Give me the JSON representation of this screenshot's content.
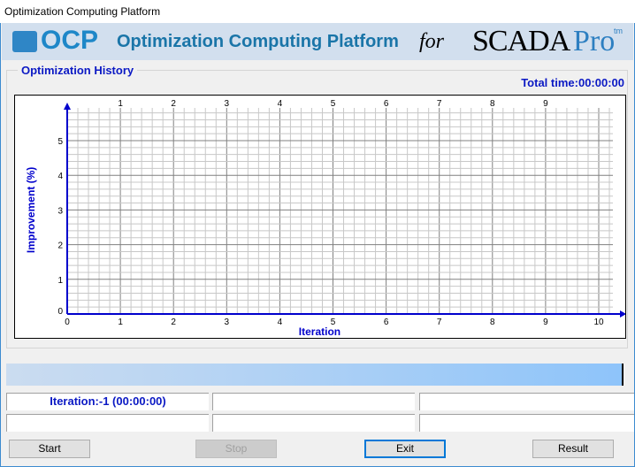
{
  "window": {
    "title": "Optimization Computing Platform"
  },
  "banner": {
    "logo": "OCP",
    "title": "Optimization Computing Platform",
    "for": "for",
    "scada": "SCADA",
    "pro": "Pro",
    "tm": "tm"
  },
  "group": {
    "label": "Optimization History",
    "total_time": "Total time:00:00:00"
  },
  "chart_data": {
    "type": "line",
    "xlabel": "Iteration",
    "ylabel": "Improvement (%)",
    "xlim": [
      0,
      10
    ],
    "ylim": [
      0,
      6
    ],
    "x_ticks": [
      "0",
      "1",
      "2",
      "3",
      "4",
      "5",
      "6",
      "7",
      "8",
      "9",
      "10"
    ],
    "top_ticks": [
      "1",
      "2",
      "3",
      "4",
      "5",
      "6",
      "7",
      "8",
      "9"
    ],
    "y_ticks": [
      "0",
      "1",
      "2",
      "3",
      "4",
      "5"
    ],
    "grid": true,
    "series": [],
    "axis_color": "#0000cc"
  },
  "progress": {
    "value": 0
  },
  "status": {
    "cells": [
      "Iteration:-1 (00:00:00)",
      "",
      "",
      "",
      "",
      ""
    ]
  },
  "buttons": {
    "start": "Start",
    "stop": "Stop",
    "exit": "Exit",
    "result": "Result"
  }
}
